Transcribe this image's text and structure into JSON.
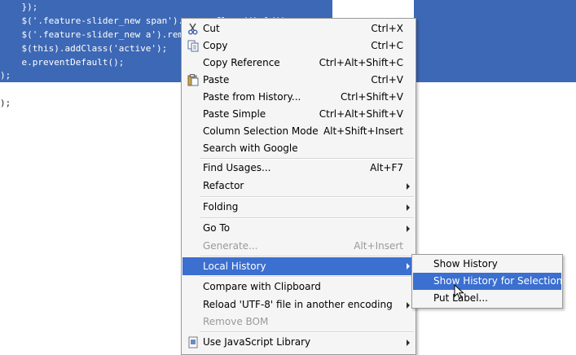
{
  "editor": {
    "lines": [
      {
        "text": "    });",
        "selected": true
      },
      {
        "text": "    $('.feature-slider_new span').removeClass('hold');",
        "selected": true
      },
      {
        "text": "    $('.feature-slider_new a').removeClass('active');",
        "selected": true
      },
      {
        "text": "    $(this).addClass('active');",
        "selected": true
      },
      {
        "text": "    e.preventDefault();",
        "selected": true
      },
      {
        "text": ");",
        "selected": true
      },
      {
        "text": "",
        "selected": false
      },
      {
        "text": ");",
        "selected": false
      }
    ]
  },
  "context_menu": {
    "items": [
      {
        "label": "Cut",
        "shortcut": "Ctrl+X",
        "icon": "scissors-icon"
      },
      {
        "label": "Copy",
        "shortcut": "Ctrl+C",
        "icon": "copy-icon"
      },
      {
        "label": "Copy Reference",
        "shortcut": "Ctrl+Alt+Shift+C"
      },
      {
        "label": "Paste",
        "shortcut": "Ctrl+V",
        "icon": "paste-icon"
      },
      {
        "label": "Paste from History...",
        "shortcut": "Ctrl+Shift+V"
      },
      {
        "label": "Paste Simple",
        "shortcut": "Ctrl+Alt+Shift+V"
      },
      {
        "label": "Column Selection Mode",
        "shortcut": "Alt+Shift+Insert"
      },
      {
        "label": "Search with Google",
        "shortcut": ""
      },
      {
        "label": "Find Usages...",
        "shortcut": "Alt+F7"
      },
      {
        "label": "Refactor",
        "shortcut": "",
        "submenu": true
      },
      {
        "label": "Folding",
        "shortcut": "",
        "submenu": true
      },
      {
        "label": "Go To",
        "shortcut": "",
        "submenu": true
      },
      {
        "label": "Generate...",
        "shortcut": "Alt+Insert",
        "disabled": true
      },
      {
        "label": "Local History",
        "shortcut": "",
        "submenu": true,
        "highlighted": true
      },
      {
        "label": "Compare with Clipboard",
        "shortcut": ""
      },
      {
        "label": "Reload 'UTF-8' file in another encoding",
        "shortcut": "",
        "submenu": true
      },
      {
        "label": "Remove BOM",
        "shortcut": "",
        "disabled": true
      },
      {
        "label": "Use JavaScript Library",
        "shortcut": "",
        "submenu": true,
        "icon": "javascript-library-icon"
      }
    ]
  },
  "submenu": {
    "items": [
      {
        "label": "Show History"
      },
      {
        "label": "Show History for Selection",
        "highlighted": true
      },
      {
        "label": "Put Label..."
      }
    ]
  },
  "colors": {
    "selection": "#3d68b5",
    "menu_highlight": "#3b6fd0",
    "menu_background": "#f5f5f5",
    "disabled_text": "#9a9a9a"
  }
}
